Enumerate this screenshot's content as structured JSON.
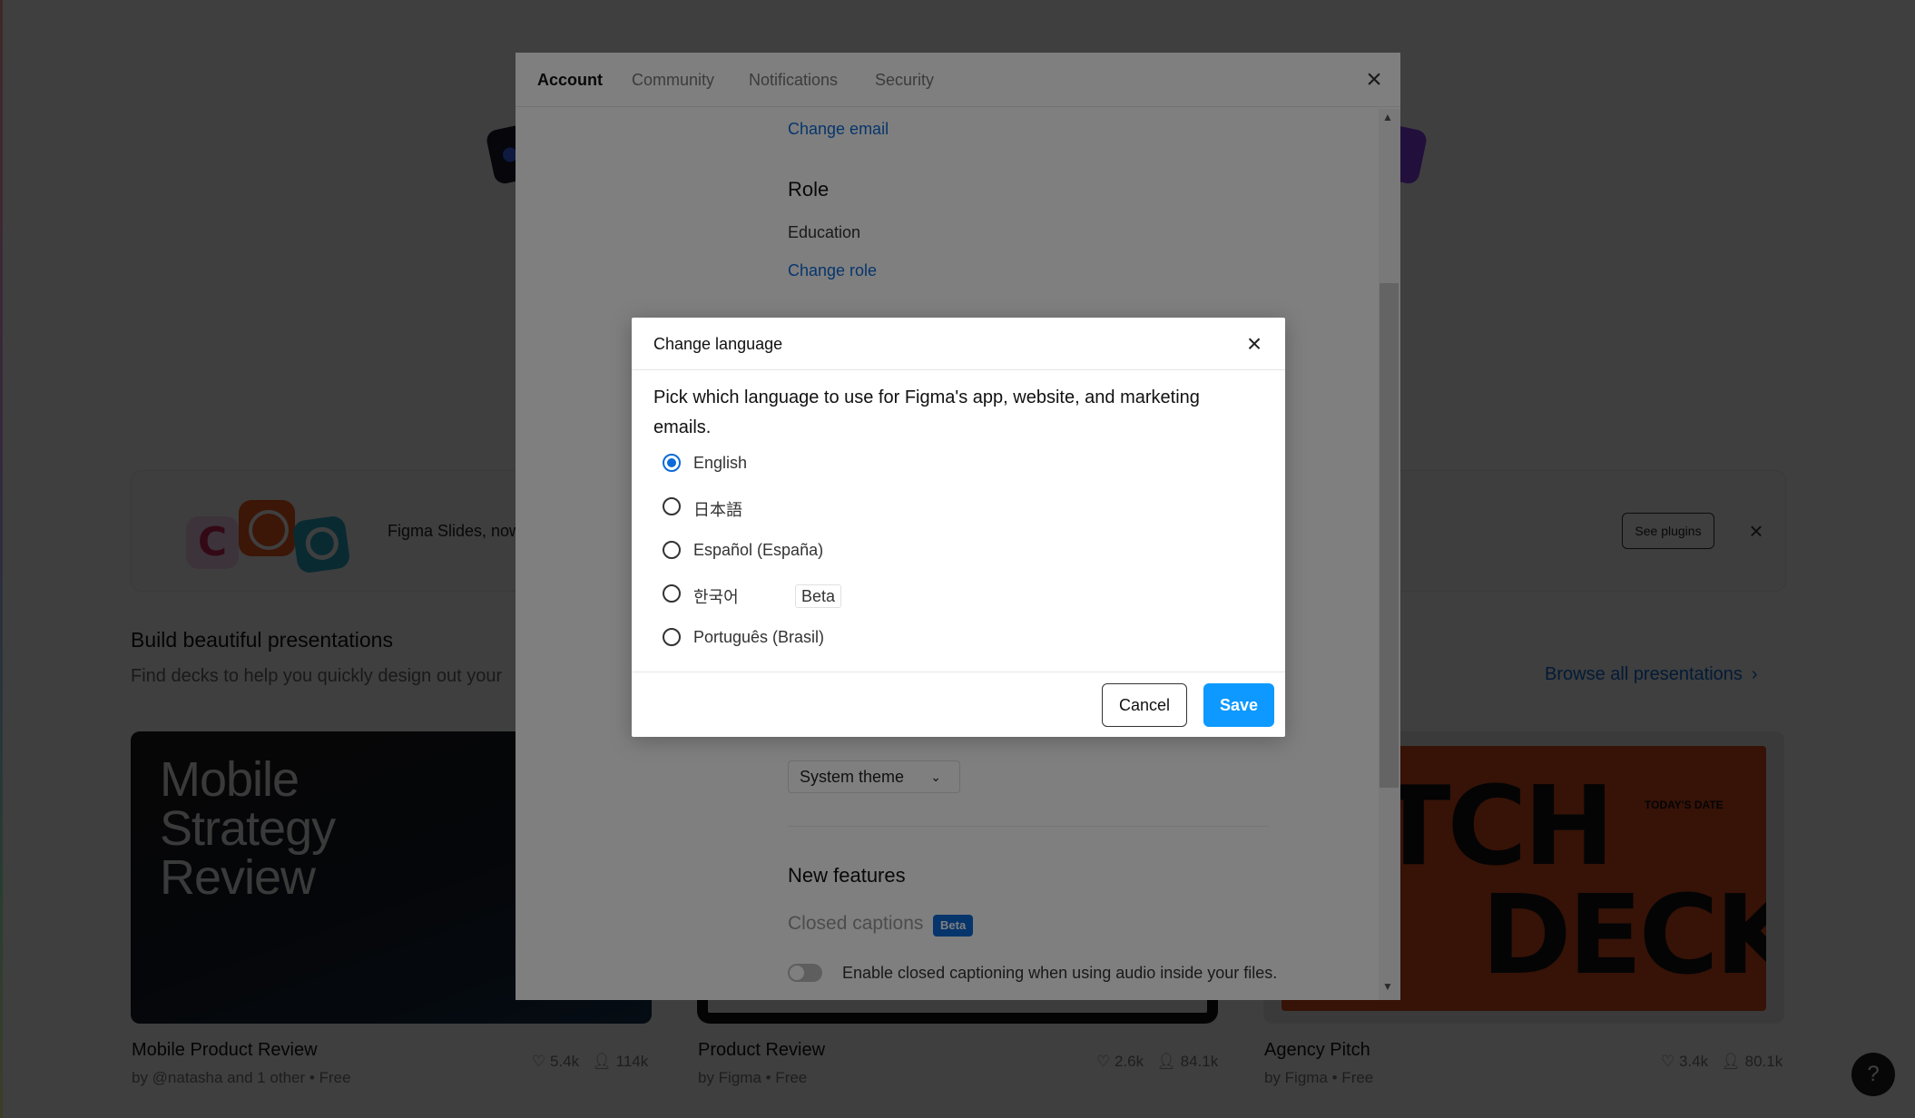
{
  "background": {
    "banner": {
      "text": "Figma Slides, now",
      "button_label": "See plugins",
      "close_icon": "×"
    },
    "section": {
      "title": "Build beautiful presentations",
      "subtitle": "Find decks to help you quickly design out your",
      "browse_label": "Browse all presentations",
      "browse_chevron": "›"
    },
    "cards": [
      {
        "thumb_text": "Mobile Strategy Review",
        "title": "Mobile Product Review",
        "meta": "by @natasha and 1 other  •  Free",
        "likes": "5.4k",
        "users": "114k"
      },
      {
        "title": "Product Review",
        "meta": "by Figma  •  Free",
        "likes": "2.6k",
        "users": "84.1k"
      },
      {
        "thumb_word1": "PITCH",
        "thumb_word2": "DECK",
        "thumb_date": "TODAY'S DATE",
        "title": "Agency Pitch",
        "meta": "by Figma  •  Free",
        "likes": "3.4k",
        "users": "80.1k"
      }
    ],
    "help_label": "?"
  },
  "settings": {
    "tabs": [
      "Account",
      "Community",
      "Notifications",
      "Security"
    ],
    "active_tab": "Account",
    "close_icon": "×",
    "change_email": "Change email",
    "role_heading": "Role",
    "role_value": "Education",
    "change_role": "Change role",
    "theme_value": "System theme",
    "theme_chevron": "⌄",
    "new_features_heading": "New features",
    "closed_captions_label": "Closed captions",
    "closed_captions_badge": "Beta",
    "closed_captions_toggle_label": "Enable closed captioning when using audio inside your files.",
    "closed_captions_enabled": false,
    "scroll_up": "▲",
    "scroll_down": "▼"
  },
  "dialog": {
    "title": "Change language",
    "close_icon": "×",
    "description": "Pick which language to use for Figma's app, website, and marketing emails.",
    "options": [
      {
        "label": "English",
        "checked": true
      },
      {
        "label": "日本語",
        "checked": false
      },
      {
        "label": "Español (España)",
        "checked": false
      },
      {
        "label": "한국어",
        "checked": false,
        "badge": "Beta"
      },
      {
        "label": "Português (Brasil)",
        "checked": false
      }
    ],
    "cancel_label": "Cancel",
    "save_label": "Save"
  },
  "colors": {
    "accent": "#0d99ff",
    "link": "#0d6bd9"
  }
}
